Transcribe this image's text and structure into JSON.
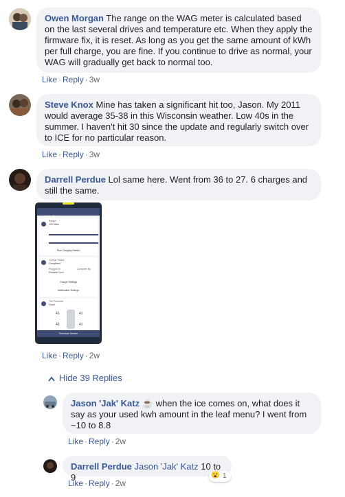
{
  "comments": [
    {
      "author": "Owen Morgan",
      "text": "The range on the WAG meter is calculated based on the last several drives and temperature etc. When they apply the firmware fix, it is reset. As long as you get the same amount of kWh per full charge, you are fine. If you continue to drive as normal, your WAG will gradually get back to normal too.",
      "like": "Like",
      "reply": "Reply",
      "time": "3w"
    },
    {
      "author": "Steve Knox",
      "text": "Mine has taken a significant hit too, Jason. My 2011 would average 35-38 in this Wisconsin weather. Low 40s in the summer. I haven't hit 30 since the update and regularly switch over to ICE for no particular reason.",
      "like": "Like",
      "reply": "Reply",
      "time": "3w"
    },
    {
      "author": "Darrell Perdue",
      "text": "Lol same here. Went from 36 to 27. 6 charges and still the same.",
      "like": "Like",
      "reply": "Reply",
      "time": "2w"
    }
  ],
  "hide_replies": "Hide 39 Replies",
  "replies": [
    {
      "author": "Jason 'Jak' Katz",
      "emoji": "☕",
      "text": "when the ice comes on, what does it say as your used kwh amount in the leaf menu? I went from ~10 to 8.8",
      "like": "Like",
      "reply": "Reply",
      "time": "2w"
    },
    {
      "author": "Darrell Perdue",
      "mention": "Jason 'Jak' Katz",
      "text": "10 to 9",
      "like": "Like",
      "reply": "Reply",
      "time": "2w",
      "reaction_emoji": "😮",
      "reaction_count": "1"
    }
  ],
  "phone_screenshot": {
    "header": "Vehicle Status",
    "range_label": "Range",
    "range_value": "129 Miles",
    "find_charging": "Find Charging Station",
    "charge_status_label": "Charge Status",
    "charge_status_value": "Completed",
    "plugged_label": "Plugged In",
    "plugged_value": "Portable Cord",
    "complete_label": "Complete By",
    "charge_settings": "Charge Settings",
    "notification_settings": "Notification Settings",
    "tire_label": "Tire Pressure",
    "tire_status": "Good",
    "tires": [
      "41",
      "41",
      "42",
      "41"
    ],
    "schedule": "Schedule Service"
  }
}
